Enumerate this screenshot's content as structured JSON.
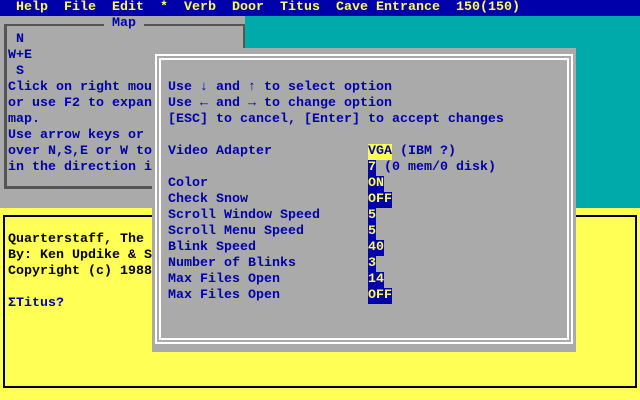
{
  "menubar": {
    "items": [
      "Help",
      "File",
      "Edit",
      "*",
      "Verb",
      "Door",
      "Titus"
    ],
    "location": "Cave Entrance",
    "score": "150(150)"
  },
  "map_panel": {
    "title": "Map",
    "lines": [
      " N",
      "W+E",
      " S",
      "Click on right mou",
      "or use F2 to expan",
      "map.",
      "Use arrow keys or",
      "over N,S,E or W to",
      "in the direction i"
    ]
  },
  "console": {
    "lines": [
      "Quarterstaff, The",
      "By: Ken Updike & S",
      "Copyright (c) 1988"
    ],
    "prompt": "ΣTitus?"
  },
  "dialog": {
    "instructions": [
      "Use ↓ and ↑ to select option",
      "Use ← and → to change option",
      "[ESC] to cancel, [Enter] to accept changes"
    ],
    "options": [
      {
        "label": "Video Adapter",
        "value": "VGA",
        "note": " (IBM ?)",
        "selected": true
      },
      {
        "label": "",
        "value": "7",
        "note": " (0 mem/0 disk)"
      },
      {
        "label": "Color",
        "value": "ON"
      },
      {
        "label": "Check Snow",
        "value": "OFF"
      },
      {
        "label": "Scroll Window Speed",
        "value": "5"
      },
      {
        "label": "Scroll Menu Speed",
        "value": "5"
      },
      {
        "label": "Blink Speed",
        "value": "40"
      },
      {
        "label": "Number of Blinks",
        "value": "3"
      },
      {
        "label": "Max Files Open",
        "value": "14"
      },
      {
        "label": "Max Files Open",
        "value": "OFF"
      }
    ]
  },
  "colors": {
    "menubar_bg": "#0000AA",
    "menubar_fg": "#FFFF55",
    "desktop": "#00AAAA",
    "panel": "#AAAAAA",
    "console_bg": "#FFFF55",
    "text_blue": "#0000AA"
  }
}
